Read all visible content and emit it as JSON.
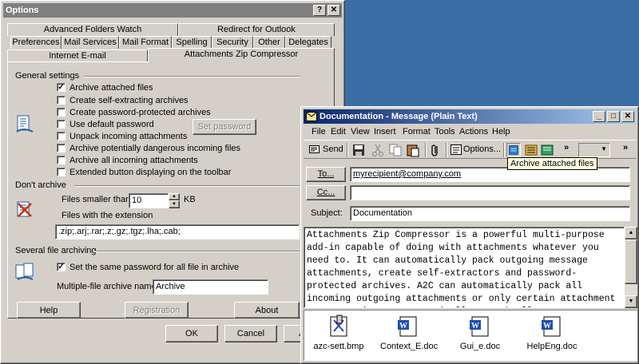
{
  "options_window": {
    "title": "Options",
    "help_btn": "?",
    "close_btn": "✕",
    "tabs_row1": [
      "Advanced Folders Watch",
      "Redirect for Outlook"
    ],
    "tabs_row2": [
      "Preferences",
      "Mail Services",
      "Mail Format",
      "Spelling",
      "Security",
      "Other",
      "Delegates"
    ],
    "tabs_row3": [
      "Internet E-mail",
      "Attachments Zip Compressor"
    ],
    "general": {
      "title": "General settings",
      "items": [
        {
          "label": "Archive attached files",
          "checked": true
        },
        {
          "label": "Create self-extracting archives",
          "checked": false
        },
        {
          "label": "Create password-protected archives",
          "checked": false
        },
        {
          "label": "Use default password",
          "checked": false
        },
        {
          "label": "Unpack incoming attachments",
          "checked": false
        },
        {
          "label": "Archive potentially dangerous incoming files",
          "checked": false
        },
        {
          "label": "Archive all incoming attachments",
          "checked": false
        },
        {
          "label": "Extended button displaying on the toolbar",
          "checked": false
        }
      ],
      "set_password": "Set password"
    },
    "dont_archive": {
      "title": "Don't archive",
      "smaller_label": "Files smaller than",
      "smaller_value": "10",
      "unit": "KB",
      "ext_label": "Files with the extension",
      "ext_value": ".zip;.arj;.rar;.z;.gz;.tgz;.lha;.cab;"
    },
    "several": {
      "title": "Several file archiving",
      "same_password": "Set the same password for all file in archive",
      "same_password_checked": true,
      "name_label": "Multiple-file archive name",
      "name_value": "Archive"
    },
    "buttons": {
      "help": "Help",
      "registration": "Registration",
      "about": "About",
      "ok": "OK",
      "cancel": "Cancel",
      "apply": "Apply"
    }
  },
  "message_window": {
    "title": "Documentation - Message (Plain Text)",
    "menu": [
      "File",
      "Edit",
      "View",
      "Insert",
      "Format",
      "Tools",
      "Actions",
      "Help"
    ],
    "toolbar": {
      "send": "Send",
      "options": "Options...",
      "tooltip": "Archive attached files"
    },
    "to_btn": "To...",
    "to_value": "myrecipient@company.com",
    "cc_btn": "Cc...",
    "cc_value": "",
    "subject_label": "Subject:",
    "subject_value": "Documentation",
    "body": "Attachments Zip Compressor is a powerful multi-purpose add-in capable of doing with attachments whatever you need to. It can automatically pack outgoing message attachments, create self-extractors and password-protected archives. A2C can automatically pack all incoming outgoing attachments or only certain attachment types, or it can automatically unpack all",
    "attachments": [
      {
        "name": "azc-sett.bmp",
        "icon": "bitmap-file-icon"
      },
      {
        "name": "Context_E.doc",
        "icon": "word-document-icon"
      },
      {
        "name": "Gui_e.doc",
        "icon": "word-document-icon"
      },
      {
        "name": "HelpEng.doc",
        "icon": "word-document-icon"
      }
    ]
  },
  "colors": {
    "titlebar_active": "#0a246a",
    "titlebar_inactive": "#808080",
    "face": "#d4d0c8",
    "desktop": "#3a6ea5"
  }
}
